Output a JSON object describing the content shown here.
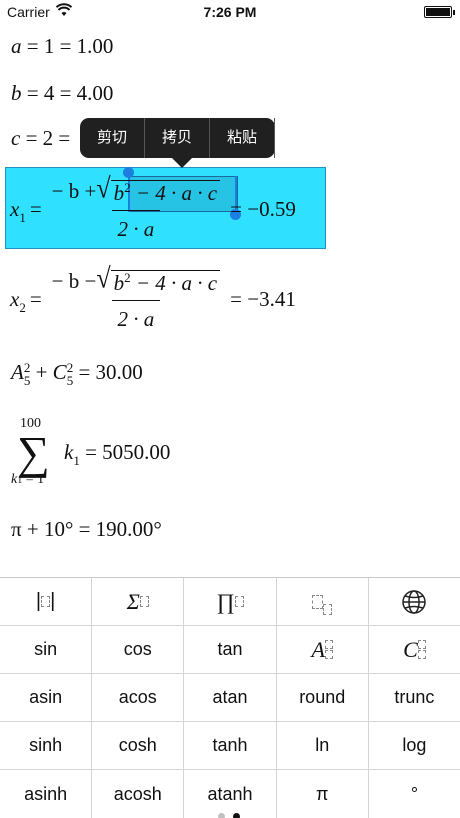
{
  "status_bar": {
    "carrier": "Carrier",
    "time": "7:26 PM",
    "battery_level": 1.0
  },
  "expressions": {
    "a": {
      "var": "a",
      "rest": " = 1 = 1.00"
    },
    "b": {
      "var": "b",
      "rest": " = 4 = 4.00"
    },
    "c": {
      "var": "c",
      "rest": " = 2 = "
    },
    "x1": {
      "lhs": "x",
      "sub": "1",
      "num_left": "− b + ",
      "radicand_a": "b",
      "radicand_sup": "2",
      "radicand_rest": " − 4 · a · c",
      "den": "2 · a",
      "result": "= −0.59"
    },
    "x2": {
      "lhs": "x",
      "sub": "2",
      "num_left": "− b − ",
      "radicand_a": "b",
      "radicand_sup": "2",
      "radicand_rest": " − 4 · a · c",
      "den": "2 · a",
      "result": "= −3.41"
    },
    "perm": {
      "A": "A",
      "A_sub": "5",
      "A_sup": "2",
      "plus": " + ",
      "C": "C",
      "C_sub": "5",
      "C_sup": "2",
      "result": " = 30.00"
    },
    "sum": {
      "upper": "100",
      "sigma": "∑",
      "lower": "k",
      "lower_sub": "1",
      "lower_rest": " = 1",
      "term": "k",
      "term_sub": "1",
      "result": " = 5050.00"
    },
    "pi": {
      "text": "π + 10° = 190.00°"
    }
  },
  "context_menu": {
    "items": [
      "剪切",
      "拷贝",
      "粘贴"
    ]
  },
  "keyboard": {
    "row1": [
      "abs-template",
      "sum-template",
      "product-template",
      "subscript-template",
      "globe"
    ],
    "row1_labels": {
      "sum": "Σ",
      "product": "∏"
    },
    "row2": [
      "sin",
      "cos",
      "tan",
      "A",
      "C"
    ],
    "row3": [
      "asin",
      "acos",
      "atan",
      "round",
      "trunc"
    ],
    "row4": [
      "sinh",
      "cosh",
      "tanh",
      "ln",
      "log"
    ],
    "row5": [
      "asinh",
      "acosh",
      "atanh",
      "π",
      "°"
    ]
  }
}
